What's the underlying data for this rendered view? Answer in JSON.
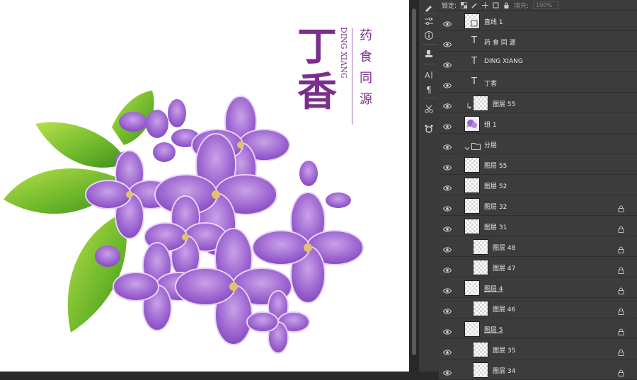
{
  "canvas": {
    "title_chars": "丁香",
    "subtitle_latin": "DING XIANG",
    "slogan": [
      "药",
      "食",
      "同",
      "源"
    ]
  },
  "lock_bar": {
    "label": "锁定:",
    "fill_label": "填充:",
    "fill_value": "100%"
  },
  "layers": [
    {
      "name": "直线 1",
      "kind": "shape",
      "locked": false,
      "clip": false
    },
    {
      "name": "药 食 同 源",
      "kind": "text",
      "locked": false,
      "clip": false
    },
    {
      "name": "DING XIANG",
      "kind": "text",
      "locked": false,
      "clip": false
    },
    {
      "name": "丁香",
      "kind": "text",
      "locked": false,
      "clip": false
    },
    {
      "name": "图层 55",
      "kind": "pixel",
      "locked": false,
      "clip": true
    },
    {
      "name": "组 1",
      "kind": "smart",
      "locked": false,
      "clip": false
    },
    {
      "name": "分层",
      "kind": "group",
      "locked": false,
      "clip": false
    },
    {
      "name": "图层 55",
      "kind": "pixel",
      "locked": false,
      "clip": false
    },
    {
      "name": "图层 52",
      "kind": "pixel",
      "locked": false,
      "clip": false
    },
    {
      "name": "图层 32",
      "kind": "pixel",
      "locked": true,
      "clip": false
    },
    {
      "name": "图层 31",
      "kind": "pixel",
      "locked": true,
      "clip": false
    },
    {
      "name": "图层 48",
      "kind": "pixel",
      "locked": true,
      "clip": true
    },
    {
      "name": "图层 47",
      "kind": "pixel",
      "locked": true,
      "clip": true
    },
    {
      "name": "图层 4",
      "kind": "pixel",
      "locked": true,
      "clip": false,
      "underline": true
    },
    {
      "name": "图层 46",
      "kind": "pixel",
      "locked": true,
      "clip": true
    },
    {
      "name": "图层 5",
      "kind": "pixel",
      "locked": true,
      "clip": false,
      "underline": true
    },
    {
      "name": "图层 35",
      "kind": "pixel",
      "locked": true,
      "clip": true
    },
    {
      "name": "图层 34",
      "kind": "pixel",
      "locked": true,
      "clip": true
    }
  ],
  "tools": [
    "brush-settings-icon",
    "adjustments-icon",
    "info-icon",
    "clone-source-icon",
    "character-icon",
    "paragraph-icon",
    "tool-presets-icon",
    "puppet-icon"
  ],
  "colors": {
    "accent_purple": "#7b2f8c",
    "panel_bg": "#3c3c3c"
  }
}
